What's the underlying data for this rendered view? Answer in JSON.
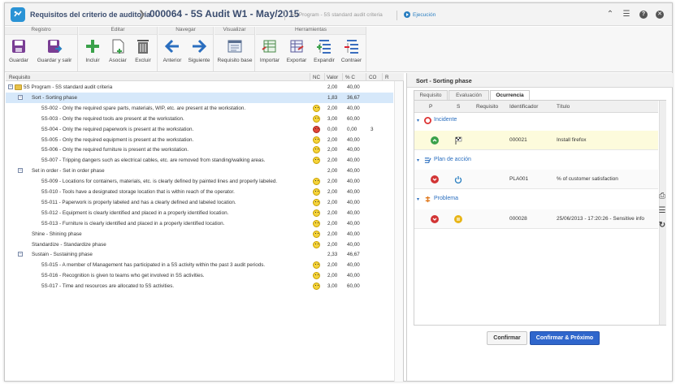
{
  "header": {
    "title": "Requisitos del criterio de auditoría",
    "record_title": "000064 - 5S Audit W1 - May/2015",
    "subtitle": "5S Program - 5S standard audit criteria",
    "status": "Ejecución",
    "icons": [
      "collapse-icon",
      "list-icon",
      "help-icon",
      "close-icon"
    ]
  },
  "toolbar": {
    "groups": [
      {
        "title": "Registro",
        "buttons": [
          "Guardar",
          "Guardar y salir"
        ]
      },
      {
        "title": "Editar",
        "buttons": [
          "Incluir",
          "Asociar",
          "Excluir"
        ]
      },
      {
        "title": "Navegar",
        "buttons": [
          "Anterior",
          "Siguiente"
        ]
      },
      {
        "title": "Visualizar",
        "buttons": [
          "Requisito base"
        ]
      },
      {
        "title": "Herramientas",
        "buttons": [
          "Importar",
          "Exportar",
          "Expandir",
          "Contraer"
        ]
      }
    ]
  },
  "grid": {
    "columns": [
      "Requisito",
      "NC",
      "Valor",
      "% C",
      "CO",
      "R"
    ],
    "rows": [
      {
        "text": "5S Program - 5S standard audit criteria",
        "level": 0,
        "type": "root",
        "nc": "",
        "valor": "2,00",
        "pc": "40,00",
        "co": ""
      },
      {
        "text": "Sort - Sorting phase",
        "level": 1,
        "type": "group",
        "nc": "",
        "valor": "1,83",
        "pc": "36,67",
        "co": "",
        "selected": true
      },
      {
        "text": "5S-002 - Only the required spare parts, materials, WIP, etc. are present at the workstation.",
        "level": 2,
        "type": "item",
        "nc": "yellow",
        "valor": "2,00",
        "pc": "40,00",
        "co": ""
      },
      {
        "text": "5S-003 - Only the required tools are present at the workstation.",
        "level": 2,
        "type": "item",
        "nc": "yellow",
        "valor": "3,00",
        "pc": "60,00",
        "co": ""
      },
      {
        "text": "5S-004 - Only the required paperwork is present at the workstation.",
        "level": 2,
        "type": "item",
        "nc": "red",
        "valor": "0,00",
        "pc": "0,00",
        "co": "3"
      },
      {
        "text": "5S-005 - Only the required equipment is present at the workstation.",
        "level": 2,
        "type": "item",
        "nc": "yellow",
        "valor": "2,00",
        "pc": "40,00",
        "co": ""
      },
      {
        "text": "5S-006 - Only the required furniture is present at the workstation.",
        "level": 2,
        "type": "item",
        "nc": "yellow",
        "valor": "2,00",
        "pc": "40,00",
        "co": ""
      },
      {
        "text": "5S-007 - Tripping dangers such as electrical cables, etc. are removed from standing/walking areas.",
        "level": 2,
        "type": "item",
        "nc": "yellow",
        "valor": "2,00",
        "pc": "40,00",
        "co": ""
      },
      {
        "text": "Set in order - Set in order phase",
        "level": 1,
        "type": "group",
        "nc": "",
        "valor": "2,00",
        "pc": "40,00",
        "co": ""
      },
      {
        "text": "5S-009 - Locations for containers, materials, etc. is clearly defined by painted lines and properly labeled.",
        "level": 2,
        "type": "item",
        "nc": "yellow",
        "valor": "2,00",
        "pc": "40,00",
        "co": ""
      },
      {
        "text": "5S-010 - Tools have a designated storage location that is within reach of the operator.",
        "level": 2,
        "type": "item",
        "nc": "yellow",
        "valor": "2,00",
        "pc": "40,00",
        "co": ""
      },
      {
        "text": "5S-011 - Paperwork is properly labeled and has a clearly defined and labeled location.",
        "level": 2,
        "type": "item",
        "nc": "yellow",
        "valor": "2,00",
        "pc": "40,00",
        "co": ""
      },
      {
        "text": "5S-012 - Equipment is clearly identified and placed in a properly identified location.",
        "level": 2,
        "type": "item",
        "nc": "yellow",
        "valor": "2,00",
        "pc": "40,00",
        "co": ""
      },
      {
        "text": "5S-013 - Furniture is clearly identified and placed in a properly identified location.",
        "level": 2,
        "type": "item",
        "nc": "yellow",
        "valor": "2,00",
        "pc": "40,00",
        "co": ""
      },
      {
        "text": "Shine - Shining phase",
        "level": 1,
        "type": "leafgroup",
        "nc": "yellow",
        "valor": "2,00",
        "pc": "40,00",
        "co": ""
      },
      {
        "text": "Standardize - Standardize phase",
        "level": 1,
        "type": "leafgroup",
        "nc": "yellow",
        "valor": "2,00",
        "pc": "40,00",
        "co": ""
      },
      {
        "text": "Sustain - Sustaining phase",
        "level": 1,
        "type": "group",
        "nc": "",
        "valor": "2,33",
        "pc": "46,67",
        "co": ""
      },
      {
        "text": "5S-015 - A member of Management has participated in a 5S activity within the past 3 audit periods.",
        "level": 2,
        "type": "item",
        "nc": "yellow",
        "valor": "2,00",
        "pc": "40,00",
        "co": ""
      },
      {
        "text": "5S-016 - Recognition is given to teams who get involved in 5S activities.",
        "level": 2,
        "type": "item",
        "nc": "yellow",
        "valor": "2,00",
        "pc": "40,00",
        "co": ""
      },
      {
        "text": "5S-017 - Time and resources are allocated to 5S activities.",
        "level": 2,
        "type": "item",
        "nc": "yellow",
        "valor": "3,00",
        "pc": "60,00",
        "co": ""
      }
    ]
  },
  "right_panel": {
    "title": "Sort - Sorting phase",
    "tabs": [
      "Requisito",
      "Evaluación",
      "Ocurrencia"
    ],
    "active_tab": "Ocurrencia",
    "columns": [
      "P",
      "S",
      "Requisito",
      "Identificador",
      "Título"
    ],
    "sections": [
      {
        "label": "Incidente",
        "rows": [
          {
            "p": "up-green",
            "s": "flag-icon",
            "id": "000021",
            "title": "Install firefox",
            "highlight": true
          }
        ]
      },
      {
        "label": "Plan de acción",
        "rows": [
          {
            "p": "down-red",
            "s": "power-icon",
            "id": "PLA001",
            "title": "% of customer satisfaction",
            "highlight": false
          }
        ]
      },
      {
        "label": "Problema",
        "rows": [
          {
            "p": "down-red",
            "s": "pause-icon",
            "id": "000028",
            "title": "25/06/2013 - 17:20:26 - Sensitive info",
            "highlight": false
          }
        ]
      }
    ],
    "buttons": {
      "confirm": "Confirmar",
      "confirm_next": "Confirmar & Próximo"
    }
  }
}
